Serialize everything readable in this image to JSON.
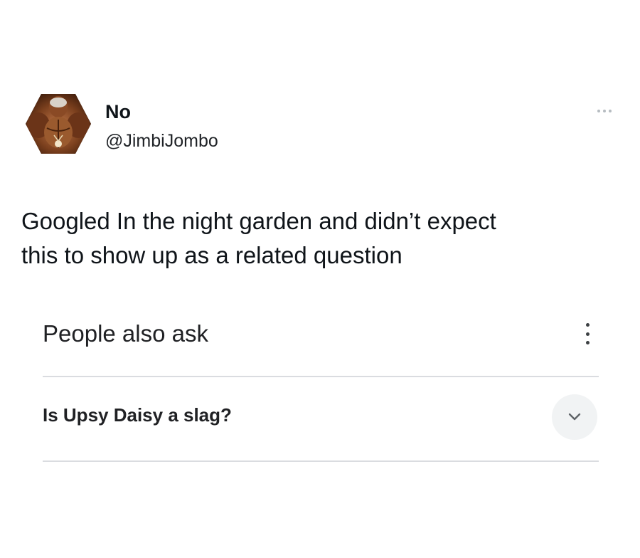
{
  "tweet": {
    "author": {
      "display_name": "No",
      "handle": "@JimbiJombo",
      "avatar_icon": "bodybuilder-photo-avatar"
    },
    "more_icon": "more-horizontal-icon",
    "text_lines": [
      "Googled In the night garden and didn’t expect",
      "this to show up as a related question"
    ]
  },
  "embedded_screenshot": {
    "section_title": "People also ask",
    "menu_icon": "more-vertical-icon",
    "questions": [
      {
        "text": "Is Upsy Daisy a slag?",
        "expand_icon": "chevron-down-icon"
      }
    ],
    "colors": {
      "divider": "#dadce0",
      "expand_button_bg": "#f1f3f4",
      "text": "#202124"
    }
  }
}
